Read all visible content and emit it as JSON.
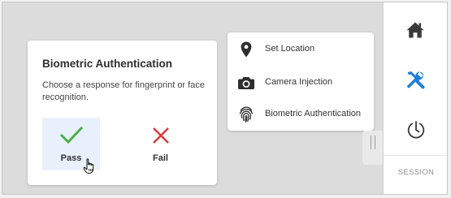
{
  "dialog": {
    "title": "Biometric Authentication",
    "description": "Choose a response for fingerprint or face recognition.",
    "options": [
      {
        "label": "Pass",
        "icon": "checkmark-icon",
        "color": "#4cae4c",
        "selected": true
      },
      {
        "label": "Fail",
        "icon": "x-icon",
        "color": "#e0393e",
        "selected": false
      }
    ]
  },
  "tools_menu": {
    "items": [
      {
        "label": "Set Location",
        "icon": "location-pin-icon"
      },
      {
        "label": "Camera Injection",
        "icon": "camera-icon"
      },
      {
        "label": "Biometric Authentication",
        "icon": "fingerprint-icon"
      }
    ]
  },
  "side_rail": {
    "buttons": [
      {
        "name": "home",
        "icon": "home-icon",
        "active": false
      },
      {
        "name": "tools",
        "icon": "tools-icon",
        "active": true
      },
      {
        "name": "power",
        "icon": "power-icon",
        "active": false
      }
    ],
    "session_label": "SESSION",
    "accent_color": "#1e7fd8"
  }
}
